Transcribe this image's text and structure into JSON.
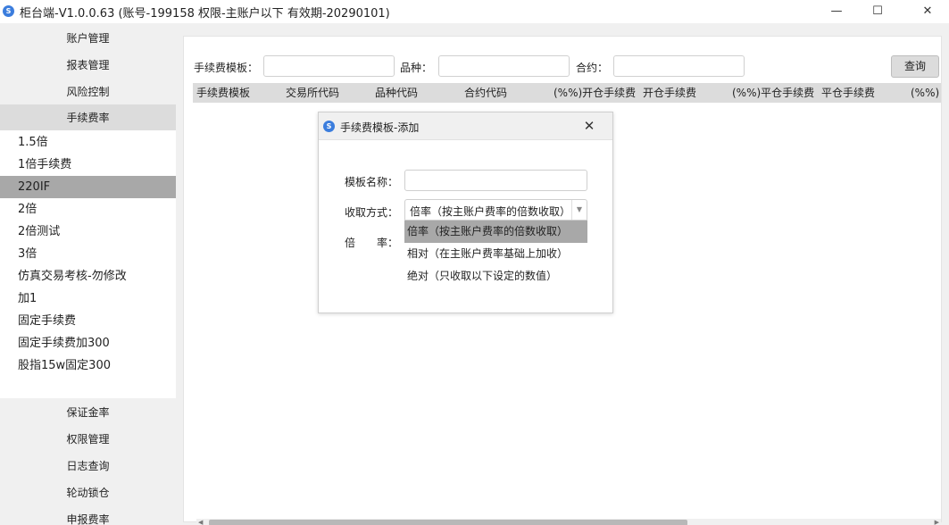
{
  "window": {
    "icon_text": "S",
    "title": "柜台端-V1.0.0.63 (账号-199158 权限-主账户以下 有效期-20290101)",
    "min": "—",
    "max": "☐",
    "close": "✕"
  },
  "sidebar": {
    "top_items": [
      "账户管理",
      "报表管理",
      "风险控制",
      "手续费率"
    ],
    "active_item": "手续费率",
    "templates": [
      "1.5倍",
      "1倍手续费",
      "220IF",
      "2倍",
      "2倍测试",
      "3倍",
      "仿真交易考核-勿修改",
      "加1",
      "固定手续费",
      "固定手续费加300",
      "股指15w固定300"
    ],
    "selected_template": "220IF",
    "bottom_items": [
      "保证金率",
      "权限管理",
      "日志查询",
      "轮动锁仓",
      "申报费率"
    ]
  },
  "filters": {
    "template_label": "手续费模板：",
    "variety_label": "品种：",
    "contract_label": "合约：",
    "query_button": "查询"
  },
  "table": {
    "columns": [
      "手续费模板",
      "交易所代码",
      "品种代码",
      "合约代码",
      "(%%)开仓手续费",
      "开仓手续费",
      "(%%)平仓手续费",
      "平仓手续费",
      "(%%)"
    ]
  },
  "dialog": {
    "icon_text": "S",
    "title": "手续费模板-添加",
    "close": "✕",
    "name_label": "模板名称：",
    "name_value": "",
    "method_label": "收取方式：",
    "method_value": "倍率（按主账户费率的倍数收取）",
    "rate_label": "倍　　率：",
    "options": [
      "倍率（按主账户费率的倍数收取）",
      "相对（在主账户费率基础上加收）",
      "绝对（只收取以下设定的数值）"
    ],
    "selected_option_index": 0
  },
  "colors": {
    "accent_icon": "#3b7ddd",
    "sidebar_bg": "#f0f0f0",
    "selected_bg": "#a8a8a8",
    "header_bg": "#dcdcdc"
  }
}
